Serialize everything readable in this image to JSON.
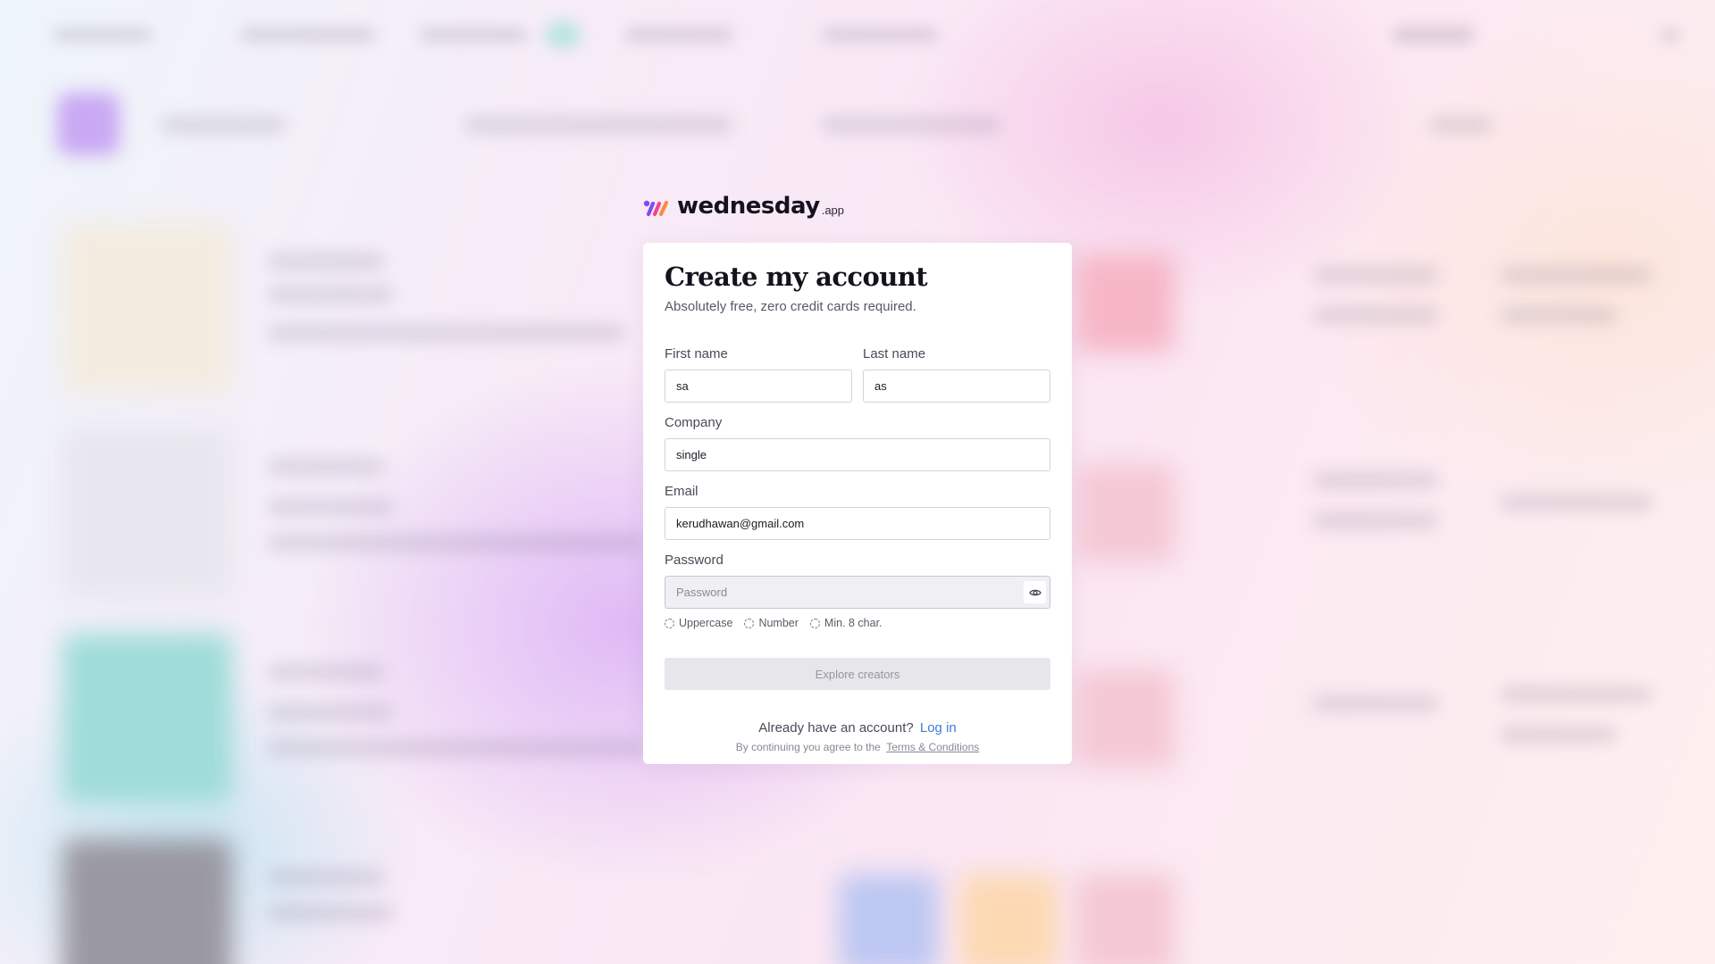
{
  "brand": {
    "name": "wednesday",
    "suffix": ".app",
    "colors": [
      "#7f4bf5",
      "#f2468e",
      "#ff9a3d"
    ]
  },
  "form": {
    "title": "Create my account",
    "subtitle": "Absolutely free, zero credit cards required.",
    "first_name": {
      "label": "First name",
      "value": "sa"
    },
    "last_name": {
      "label": "Last name",
      "value": "as"
    },
    "company": {
      "label": "Company",
      "value": "single"
    },
    "email": {
      "label": "Email",
      "value": "kerudhawan@gmail.com"
    },
    "password": {
      "label": "Password",
      "value": "",
      "placeholder": "Password",
      "toggle_icon": "eye-icon"
    },
    "password_rules": [
      "Uppercase",
      "Number",
      "Min. 8 char."
    ],
    "submit_label": "Explore creators",
    "login_prompt": "Already have an account?",
    "login_link": "Log in",
    "terms_prompt": "By continuing you agree to the",
    "terms_link": "Terms & Conditions"
  },
  "colors": {
    "accent_link": "#3b7bd6",
    "disabled_button": "#e7e6eb"
  }
}
